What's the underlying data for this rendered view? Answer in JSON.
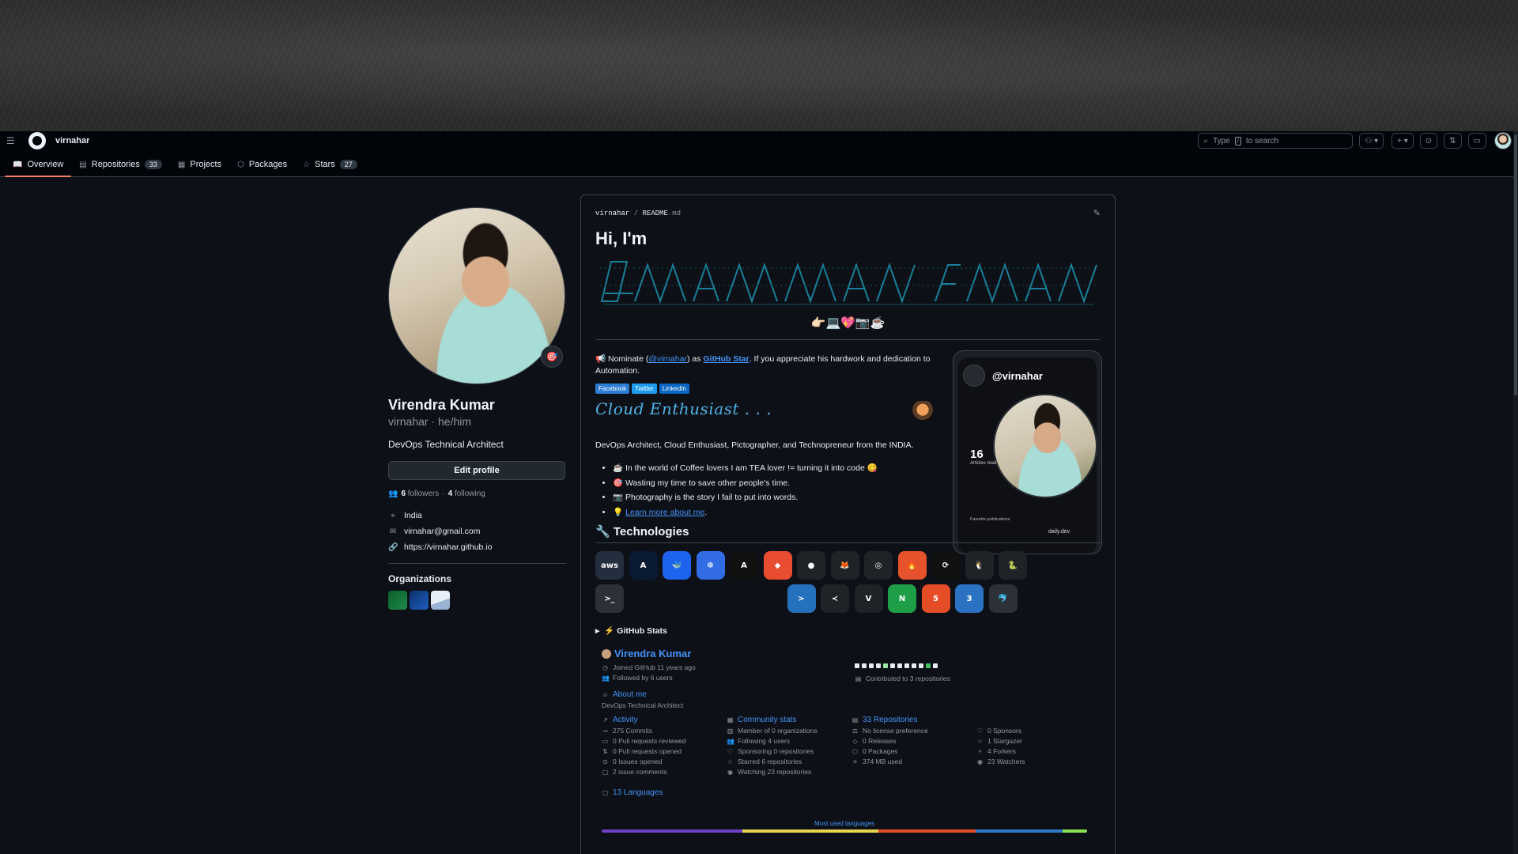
{
  "topbar": {
    "username": "virnahar",
    "search_prefix": "Type",
    "search_key": "/",
    "search_suffix": "to search"
  },
  "tabs": [
    {
      "label": "Overview",
      "count": "",
      "icon": "book-icon"
    },
    {
      "label": "Repositories",
      "count": "33",
      "icon": "repo-icon"
    },
    {
      "label": "Projects",
      "count": "",
      "icon": "table-icon"
    },
    {
      "label": "Packages",
      "count": "",
      "icon": "package-icon"
    },
    {
      "label": "Stars",
      "count": "27",
      "icon": "star-icon"
    }
  ],
  "profile": {
    "name": "Virendra Kumar",
    "login_pronouns": "virnahar · he/him",
    "bio": "DevOps Technical Architect",
    "edit_label": "Edit profile",
    "followers_count": "6",
    "followers_label": "followers",
    "separator": "·",
    "following_count": "4",
    "following_label": "following",
    "location": "India",
    "email": "virnahar@gmail.com",
    "website": "https://virnahar.github.io",
    "orgs_title": "Organizations"
  },
  "readme": {
    "owner": "virnahar",
    "slash": "/",
    "file": "README",
    "ext": ".md",
    "greeting": "Hi, I'm",
    "emojis": "👉🏻💻💖📷☕",
    "nominate_pre": "📢 Nominate (",
    "nominate_handle": "@virnahar",
    "nominate_mid": ") as ",
    "nominate_star": "GitHub Star",
    "nominate_post": ". If you appreciate his hardwork and dedication to Automation.",
    "badges": [
      "Facebook",
      "Twitter",
      "LinkedIn"
    ],
    "cloud": "Cloud Enthusiast . . .",
    "about": "DevOps Architect, Cloud Enthusiast, Pictographer, and Technopreneur from the INDIA.",
    "bullets": [
      "☕ In the world of Coffee lovers I am TEA lover != turning it into code 😋",
      "🎯 Wasting my time to save other people's time.",
      "📷 Photography is the story I fail to put into words."
    ],
    "learn_pre": "💡 ",
    "learn_link": "Learn more about me",
    "learn_post": ".",
    "tech_title": "🔧 Technologies",
    "stats_toggle": "▸",
    "stats_title": "⚡ GitHub Stats"
  },
  "devcard": {
    "handle": "@virnahar",
    "articles": "16",
    "articles_label": "Articles read",
    "favorite": "Favorite publications",
    "brand": "daily.dev"
  },
  "technologies": [
    {
      "name": "aws-icon",
      "glyph": "aws",
      "color": "#232f3e"
    },
    {
      "name": "azure-icon",
      "glyph": "A",
      "color": "#0a1a33"
    },
    {
      "name": "docker-icon",
      "glyph": "🐳",
      "color": "#1d63ed"
    },
    {
      "name": "kubernetes-icon",
      "glyph": "☸",
      "color": "#326ce5"
    },
    {
      "name": "ansible-icon",
      "glyph": "A",
      "color": "#111111"
    },
    {
      "name": "git-icon",
      "glyph": "◆",
      "color": "#e84d31"
    },
    {
      "name": "github-icon",
      "glyph": "●",
      "color": "#1f2328"
    },
    {
      "name": "gitlab-icon",
      "glyph": "🦊",
      "color": "#1f2328"
    },
    {
      "name": "grafana-icon",
      "glyph": "◎",
      "color": "#1f2328"
    },
    {
      "name": "prometheus-icon",
      "glyph": "🔥",
      "color": "#e6522c"
    },
    {
      "name": "openshift-icon",
      "glyph": "⟳",
      "color": "#111111"
    },
    {
      "name": "linux-icon",
      "glyph": "🐧",
      "color": "#1f2328"
    },
    {
      "name": "python-icon",
      "glyph": "🐍",
      "color": "#1f2328"
    },
    {
      "name": "bash-icon",
      "glyph": ">_",
      "color": "#2b3137"
    },
    {
      "name": "powershell-icon",
      "glyph": ">",
      "color": "#2671be"
    },
    {
      "name": "vscode-icon",
      "glyph": "≺",
      "color": "#1f2328"
    },
    {
      "name": "vim-icon",
      "glyph": "V",
      "color": "#1f2328"
    },
    {
      "name": "nodejs-icon",
      "glyph": "N",
      "color": "#1f9e48"
    },
    {
      "name": "html5-icon",
      "glyph": "5",
      "color": "#e44d26"
    },
    {
      "name": "css3-icon",
      "glyph": "3",
      "color": "#2c72c3"
    },
    {
      "name": "mysql-icon",
      "glyph": "🐬",
      "color": "#2b3137"
    }
  ],
  "stats": {
    "name": "Virendra Kumar",
    "joined": "Joined GitHub 11 years ago",
    "followed": "Followed by 6 users",
    "contributed": "Contributed to 3 repositories",
    "about_head": "About me",
    "about_text": "DevOps Technical Architect",
    "activity_head": "Activity",
    "activity": [
      "275 Commits",
      "0 Pull requests reviewed",
      "0 Pull requests opened",
      "0 Issues opened",
      "2 issue comments"
    ],
    "community_head": "Community stats",
    "community": [
      "Member of 0 organizations",
      "Following 4 users",
      "Sponsoring 0 repositories",
      "Starred 6 repositories",
      "Watching 23 repositories"
    ],
    "repos_head": "33 Repositories",
    "repos": [
      "No license preference",
      "0 Releases",
      "0 Packages",
      "374 MB used"
    ],
    "misc": [
      "0 Sponsors",
      "1 Stargazer",
      "4 Forkers",
      "23 Watchers"
    ],
    "languages_head": "13 Languages",
    "most_used": "Most used languages",
    "lang_colors": [
      "#6e40c9",
      "#e8d44d",
      "#e34c26",
      "#3178c6",
      "#89e051"
    ],
    "lang_shares": [
      0.29,
      0.28,
      0.2,
      0.18,
      0.05
    ]
  },
  "colors": {
    "accent": "#4493f8",
    "tab_underline": "#f78166"
  }
}
